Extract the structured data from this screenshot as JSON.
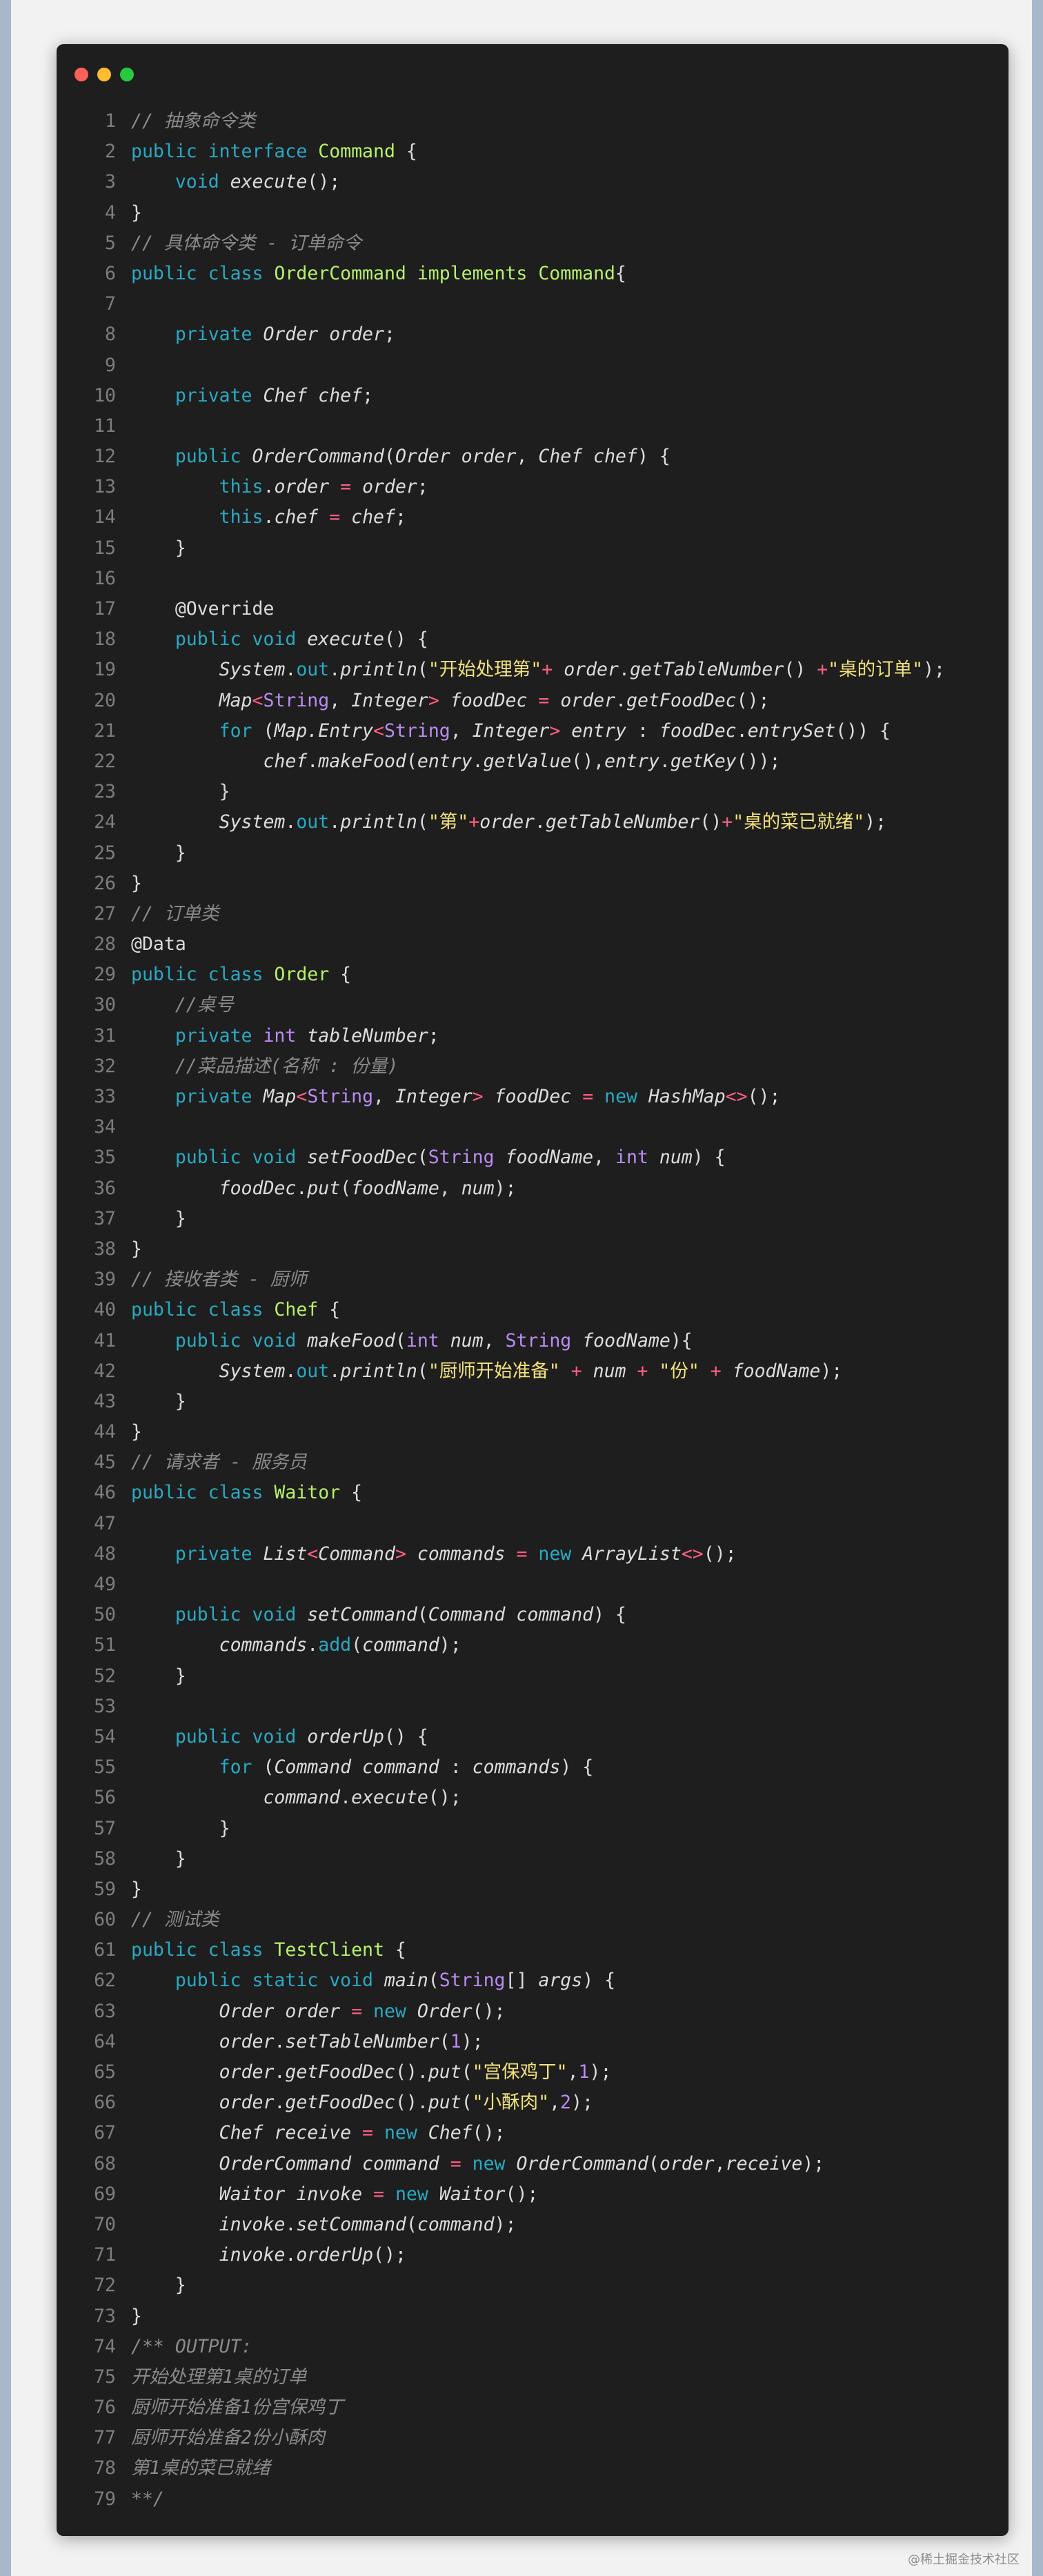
{
  "window": {
    "buttons": [
      {
        "name": "close",
        "color": "#fe5f57"
      },
      {
        "name": "minimize",
        "color": "#febc2e"
      },
      {
        "name": "maximize",
        "color": "#28c840"
      }
    ]
  },
  "palette": {
    "kw": "#2aa9c2",
    "cls": "#b6f16a",
    "it": "#dcdcdc",
    "str": "#f1e27c",
    "cm": "#8a8a8a",
    "op": "#ff5e83",
    "type": "#b98cf2",
    "num": "#b98cf2",
    "pl": "#dcdcdc"
  },
  "code_lines": [
    [
      [
        "cm",
        "// 抽象命令类"
      ]
    ],
    [
      [
        "kw",
        "public interface "
      ],
      [
        "cls",
        "Command"
      ],
      [
        "pl",
        " {"
      ]
    ],
    [
      [
        "pl",
        "    "
      ],
      [
        "kw",
        "void "
      ],
      [
        "it",
        "execute"
      ],
      [
        "pl",
        "();"
      ]
    ],
    [
      [
        "pl",
        "}"
      ]
    ],
    [
      [
        "cm",
        "// 具体命令类 - 订单命令"
      ]
    ],
    [
      [
        "kw",
        "public class "
      ],
      [
        "cls",
        "OrderCommand implements Command"
      ],
      [
        "pl",
        "{"
      ]
    ],
    [],
    [
      [
        "pl",
        "    "
      ],
      [
        "kw",
        "private "
      ],
      [
        "it",
        "Order order"
      ],
      [
        "pl",
        ";"
      ]
    ],
    [],
    [
      [
        "pl",
        "    "
      ],
      [
        "kw",
        "private "
      ],
      [
        "it",
        "Chef chef"
      ],
      [
        "pl",
        ";"
      ]
    ],
    [],
    [
      [
        "pl",
        "    "
      ],
      [
        "kw",
        "public "
      ],
      [
        "it",
        "OrderCommand"
      ],
      [
        "pl",
        "("
      ],
      [
        "it",
        "Order order"
      ],
      [
        "pl",
        ", "
      ],
      [
        "it",
        "Chef chef"
      ],
      [
        "pl",
        ") {"
      ]
    ],
    [
      [
        "pl",
        "        "
      ],
      [
        "kw",
        "this"
      ],
      [
        "pl",
        "."
      ],
      [
        "it",
        "order"
      ],
      [
        "op",
        " = "
      ],
      [
        "it",
        "order"
      ],
      [
        "pl",
        ";"
      ]
    ],
    [
      [
        "pl",
        "        "
      ],
      [
        "kw",
        "this"
      ],
      [
        "pl",
        "."
      ],
      [
        "it",
        "chef"
      ],
      [
        "op",
        " = "
      ],
      [
        "it",
        "chef"
      ],
      [
        "pl",
        ";"
      ]
    ],
    [
      [
        "pl",
        "    }"
      ]
    ],
    [],
    [
      [
        "pl",
        "    @Override"
      ]
    ],
    [
      [
        "pl",
        "    "
      ],
      [
        "kw",
        "public void "
      ],
      [
        "it",
        "execute"
      ],
      [
        "pl",
        "() {"
      ]
    ],
    [
      [
        "pl",
        "        "
      ],
      [
        "it",
        "System"
      ],
      [
        "pl",
        "."
      ],
      [
        "kw",
        "out"
      ],
      [
        "pl",
        "."
      ],
      [
        "it",
        "println"
      ],
      [
        "pl",
        "("
      ],
      [
        "str",
        "\"开始处理第\""
      ],
      [
        "op",
        "+ "
      ],
      [
        "it",
        "order"
      ],
      [
        "pl",
        "."
      ],
      [
        "it",
        "getTableNumber"
      ],
      [
        "pl",
        "() "
      ],
      [
        "op",
        "+"
      ],
      [
        "str",
        "\"桌的订单\""
      ],
      [
        "pl",
        ");"
      ]
    ],
    [
      [
        "pl",
        "        "
      ],
      [
        "it",
        "Map"
      ],
      [
        "op",
        "<"
      ],
      [
        "type",
        "String"
      ],
      [
        "pl",
        ", "
      ],
      [
        "it",
        "Integer"
      ],
      [
        "op",
        "> "
      ],
      [
        "it",
        "foodDec"
      ],
      [
        "op",
        " = "
      ],
      [
        "it",
        "order"
      ],
      [
        "pl",
        "."
      ],
      [
        "it",
        "getFoodDec"
      ],
      [
        "pl",
        "();"
      ]
    ],
    [
      [
        "pl",
        "        "
      ],
      [
        "kw",
        "for "
      ],
      [
        "pl",
        "("
      ],
      [
        "it",
        "Map.Entry"
      ],
      [
        "op",
        "<"
      ],
      [
        "type",
        "String"
      ],
      [
        "pl",
        ", "
      ],
      [
        "it",
        "Integer"
      ],
      [
        "op",
        "> "
      ],
      [
        "it",
        "entry"
      ],
      [
        "pl",
        " : "
      ],
      [
        "it",
        "foodDec"
      ],
      [
        "pl",
        "."
      ],
      [
        "it",
        "entrySet"
      ],
      [
        "pl",
        "()) {"
      ]
    ],
    [
      [
        "pl",
        "            "
      ],
      [
        "it",
        "chef"
      ],
      [
        "pl",
        "."
      ],
      [
        "it",
        "makeFood"
      ],
      [
        "pl",
        "("
      ],
      [
        "it",
        "entry"
      ],
      [
        "pl",
        "."
      ],
      [
        "it",
        "getValue"
      ],
      [
        "pl",
        "(),"
      ],
      [
        "it",
        "entry"
      ],
      [
        "pl",
        "."
      ],
      [
        "it",
        "getKey"
      ],
      [
        "pl",
        "());"
      ]
    ],
    [
      [
        "pl",
        "        }"
      ]
    ],
    [
      [
        "pl",
        "        "
      ],
      [
        "it",
        "System"
      ],
      [
        "pl",
        "."
      ],
      [
        "kw",
        "out"
      ],
      [
        "pl",
        "."
      ],
      [
        "it",
        "println"
      ],
      [
        "pl",
        "("
      ],
      [
        "str",
        "\"第\""
      ],
      [
        "op",
        "+"
      ],
      [
        "it",
        "order"
      ],
      [
        "pl",
        "."
      ],
      [
        "it",
        "getTableNumber"
      ],
      [
        "pl",
        "()"
      ],
      [
        "op",
        "+"
      ],
      [
        "str",
        "\"桌的菜已就绪\""
      ],
      [
        "pl",
        ");"
      ]
    ],
    [
      [
        "pl",
        "    }"
      ]
    ],
    [
      [
        "pl",
        "}"
      ]
    ],
    [
      [
        "cm",
        "// 订单类"
      ]
    ],
    [
      [
        "pl",
        "@Data"
      ]
    ],
    [
      [
        "kw",
        "public class "
      ],
      [
        "cls",
        "Order"
      ],
      [
        "pl",
        " {"
      ]
    ],
    [
      [
        "pl",
        "    "
      ],
      [
        "cm",
        "//桌号"
      ]
    ],
    [
      [
        "pl",
        "    "
      ],
      [
        "kw",
        "private "
      ],
      [
        "type",
        "int "
      ],
      [
        "it",
        "tableNumber"
      ],
      [
        "pl",
        ";"
      ]
    ],
    [
      [
        "pl",
        "    "
      ],
      [
        "cm",
        "//菜品描述(名称 : 份量)"
      ]
    ],
    [
      [
        "pl",
        "    "
      ],
      [
        "kw",
        "private "
      ],
      [
        "it",
        "Map"
      ],
      [
        "op",
        "<"
      ],
      [
        "type",
        "String"
      ],
      [
        "pl",
        ", "
      ],
      [
        "it",
        "Integer"
      ],
      [
        "op",
        "> "
      ],
      [
        "it",
        "foodDec"
      ],
      [
        "op",
        " = "
      ],
      [
        "kw",
        "new "
      ],
      [
        "it",
        "HashMap"
      ],
      [
        "op",
        "<>"
      ],
      [
        "pl",
        "();"
      ]
    ],
    [],
    [
      [
        "pl",
        "    "
      ],
      [
        "kw",
        "public void "
      ],
      [
        "it",
        "setFoodDec"
      ],
      [
        "pl",
        "("
      ],
      [
        "type",
        "String "
      ],
      [
        "it",
        "foodName"
      ],
      [
        "pl",
        ", "
      ],
      [
        "type",
        "int "
      ],
      [
        "it",
        "num"
      ],
      [
        "pl",
        ") {"
      ]
    ],
    [
      [
        "pl",
        "        "
      ],
      [
        "it",
        "foodDec"
      ],
      [
        "pl",
        "."
      ],
      [
        "it",
        "put"
      ],
      [
        "pl",
        "("
      ],
      [
        "it",
        "foodName"
      ],
      [
        "pl",
        ", "
      ],
      [
        "it",
        "num"
      ],
      [
        "pl",
        ");"
      ]
    ],
    [
      [
        "pl",
        "    }"
      ]
    ],
    [
      [
        "pl",
        "}"
      ]
    ],
    [
      [
        "cm",
        "// 接收者类 - 厨师"
      ]
    ],
    [
      [
        "kw",
        "public class "
      ],
      [
        "cls",
        "Chef"
      ],
      [
        "pl",
        " {"
      ]
    ],
    [
      [
        "pl",
        "    "
      ],
      [
        "kw",
        "public void "
      ],
      [
        "it",
        "makeFood"
      ],
      [
        "pl",
        "("
      ],
      [
        "type",
        "int "
      ],
      [
        "it",
        "num"
      ],
      [
        "pl",
        ", "
      ],
      [
        "type",
        "String "
      ],
      [
        "it",
        "foodName"
      ],
      [
        "pl",
        "){"
      ]
    ],
    [
      [
        "pl",
        "        "
      ],
      [
        "it",
        "System"
      ],
      [
        "pl",
        "."
      ],
      [
        "kw",
        "out"
      ],
      [
        "pl",
        "."
      ],
      [
        "it",
        "println"
      ],
      [
        "pl",
        "("
      ],
      [
        "str",
        "\"厨师开始准备\""
      ],
      [
        "op",
        " + "
      ],
      [
        "it",
        "num"
      ],
      [
        "op",
        " + "
      ],
      [
        "str",
        "\"份\""
      ],
      [
        "op",
        " + "
      ],
      [
        "it",
        "foodName"
      ],
      [
        "pl",
        ");"
      ]
    ],
    [
      [
        "pl",
        "    }"
      ]
    ],
    [
      [
        "pl",
        "}"
      ]
    ],
    [
      [
        "cm",
        "// 请求者 - 服务员"
      ]
    ],
    [
      [
        "kw",
        "public class "
      ],
      [
        "cls",
        "Waitor"
      ],
      [
        "pl",
        " {"
      ]
    ],
    [],
    [
      [
        "pl",
        "    "
      ],
      [
        "kw",
        "private "
      ],
      [
        "it",
        "List"
      ],
      [
        "op",
        "<"
      ],
      [
        "it",
        "Command"
      ],
      [
        "op",
        "> "
      ],
      [
        "it",
        "commands"
      ],
      [
        "op",
        " = "
      ],
      [
        "kw",
        "new "
      ],
      [
        "it",
        "ArrayList"
      ],
      [
        "op",
        "<>"
      ],
      [
        "pl",
        "();"
      ]
    ],
    [],
    [
      [
        "pl",
        "    "
      ],
      [
        "kw",
        "public void "
      ],
      [
        "it",
        "setCommand"
      ],
      [
        "pl",
        "("
      ],
      [
        "it",
        "Command command"
      ],
      [
        "pl",
        ") {"
      ]
    ],
    [
      [
        "pl",
        "        "
      ],
      [
        "it",
        "commands"
      ],
      [
        "pl",
        "."
      ],
      [
        "kw",
        "add"
      ],
      [
        "pl",
        "("
      ],
      [
        "it",
        "command"
      ],
      [
        "pl",
        ");"
      ]
    ],
    [
      [
        "pl",
        "    }"
      ]
    ],
    [],
    [
      [
        "pl",
        "    "
      ],
      [
        "kw",
        "public void "
      ],
      [
        "it",
        "orderUp"
      ],
      [
        "pl",
        "() {"
      ]
    ],
    [
      [
        "pl",
        "        "
      ],
      [
        "kw",
        "for "
      ],
      [
        "pl",
        "("
      ],
      [
        "it",
        "Command command"
      ],
      [
        "pl",
        " : "
      ],
      [
        "it",
        "commands"
      ],
      [
        "pl",
        ") {"
      ]
    ],
    [
      [
        "pl",
        "            "
      ],
      [
        "it",
        "command"
      ],
      [
        "pl",
        "."
      ],
      [
        "it",
        "execute"
      ],
      [
        "pl",
        "();"
      ]
    ],
    [
      [
        "pl",
        "        }"
      ]
    ],
    [
      [
        "pl",
        "    }"
      ]
    ],
    [
      [
        "pl",
        "}"
      ]
    ],
    [
      [
        "cm",
        "// 测试类"
      ]
    ],
    [
      [
        "kw",
        "public class "
      ],
      [
        "cls",
        "TestClient"
      ],
      [
        "pl",
        " {"
      ]
    ],
    [
      [
        "pl",
        "    "
      ],
      [
        "kw",
        "public static void "
      ],
      [
        "it",
        "main"
      ],
      [
        "pl",
        "("
      ],
      [
        "type",
        "String"
      ],
      [
        "pl",
        "[] "
      ],
      [
        "it",
        "args"
      ],
      [
        "pl",
        ") {"
      ]
    ],
    [
      [
        "pl",
        "        "
      ],
      [
        "it",
        "Order order"
      ],
      [
        "op",
        " = "
      ],
      [
        "kw",
        "new "
      ],
      [
        "it",
        "Order"
      ],
      [
        "pl",
        "();"
      ]
    ],
    [
      [
        "pl",
        "        "
      ],
      [
        "it",
        "order"
      ],
      [
        "pl",
        "."
      ],
      [
        "it",
        "setTableNumber"
      ],
      [
        "pl",
        "("
      ],
      [
        "num",
        "1"
      ],
      [
        "pl",
        ");"
      ]
    ],
    [
      [
        "pl",
        "        "
      ],
      [
        "it",
        "order"
      ],
      [
        "pl",
        "."
      ],
      [
        "it",
        "getFoodDec"
      ],
      [
        "pl",
        "()."
      ],
      [
        "it",
        "put"
      ],
      [
        "pl",
        "("
      ],
      [
        "str",
        "\"宫保鸡丁\""
      ],
      [
        "pl",
        ","
      ],
      [
        "num",
        "1"
      ],
      [
        "pl",
        ");"
      ]
    ],
    [
      [
        "pl",
        "        "
      ],
      [
        "it",
        "order"
      ],
      [
        "pl",
        "."
      ],
      [
        "it",
        "getFoodDec"
      ],
      [
        "pl",
        "()."
      ],
      [
        "it",
        "put"
      ],
      [
        "pl",
        "("
      ],
      [
        "str",
        "\"小酥肉\""
      ],
      [
        "pl",
        ","
      ],
      [
        "num",
        "2"
      ],
      [
        "pl",
        ");"
      ]
    ],
    [
      [
        "pl",
        "        "
      ],
      [
        "it",
        "Chef receive"
      ],
      [
        "op",
        " = "
      ],
      [
        "kw",
        "new "
      ],
      [
        "it",
        "Chef"
      ],
      [
        "pl",
        "();"
      ]
    ],
    [
      [
        "pl",
        "        "
      ],
      [
        "it",
        "OrderCommand command"
      ],
      [
        "op",
        " = "
      ],
      [
        "kw",
        "new "
      ],
      [
        "it",
        "OrderCommand"
      ],
      [
        "pl",
        "("
      ],
      [
        "it",
        "order"
      ],
      [
        "pl",
        ","
      ],
      [
        "it",
        "receive"
      ],
      [
        "pl",
        ");"
      ]
    ],
    [
      [
        "pl",
        "        "
      ],
      [
        "it",
        "Waitor invoke"
      ],
      [
        "op",
        " = "
      ],
      [
        "kw",
        "new "
      ],
      [
        "it",
        "Waitor"
      ],
      [
        "pl",
        "();"
      ]
    ],
    [
      [
        "pl",
        "        "
      ],
      [
        "it",
        "invoke"
      ],
      [
        "pl",
        "."
      ],
      [
        "it",
        "setCommand"
      ],
      [
        "pl",
        "("
      ],
      [
        "it",
        "command"
      ],
      [
        "pl",
        ");"
      ]
    ],
    [
      [
        "pl",
        "        "
      ],
      [
        "it",
        "invoke"
      ],
      [
        "pl",
        "."
      ],
      [
        "it",
        "orderUp"
      ],
      [
        "pl",
        "();"
      ]
    ],
    [
      [
        "pl",
        "    }"
      ]
    ],
    [
      [
        "pl",
        "}"
      ]
    ],
    [
      [
        "cm",
        "/** OUTPUT:"
      ]
    ],
    [
      [
        "cm",
        "开始处理第1桌的订单"
      ]
    ],
    [
      [
        "cm",
        "厨师开始准备1份宫保鸡丁"
      ]
    ],
    [
      [
        "cm",
        "厨师开始准备2份小酥肉"
      ]
    ],
    [
      [
        "cm",
        "第1桌的菜已就绪"
      ]
    ],
    [
      [
        "cm",
        "**/"
      ]
    ]
  ],
  "watermark": "@稀土掘金技术社区"
}
